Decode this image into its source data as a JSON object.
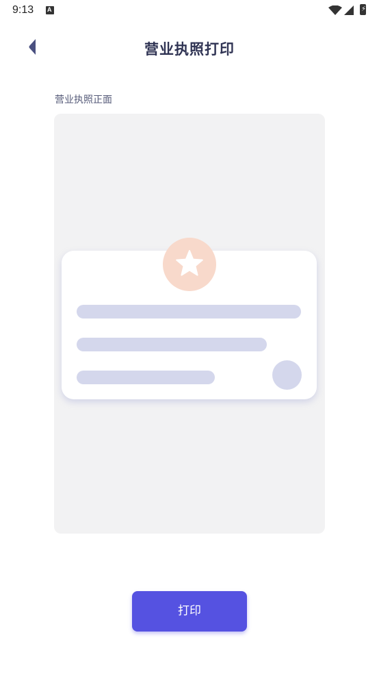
{
  "status_bar": {
    "time": "9:13",
    "notification_icon": "a-icon",
    "battery_glyph": "⚡"
  },
  "header": {
    "back_icon": "chevron-left-icon",
    "title": "营业执照打印"
  },
  "main": {
    "section_label": "营业执照正面",
    "illustration_icon": "star-icon"
  },
  "footer": {
    "print_label": "打印"
  },
  "colors": {
    "accent": "#5552e1",
    "title": "#2f3353",
    "badge": "#f8d9cb",
    "placeholder_bar": "#d4d7ec",
    "upload_bg": "#f2f2f3"
  }
}
